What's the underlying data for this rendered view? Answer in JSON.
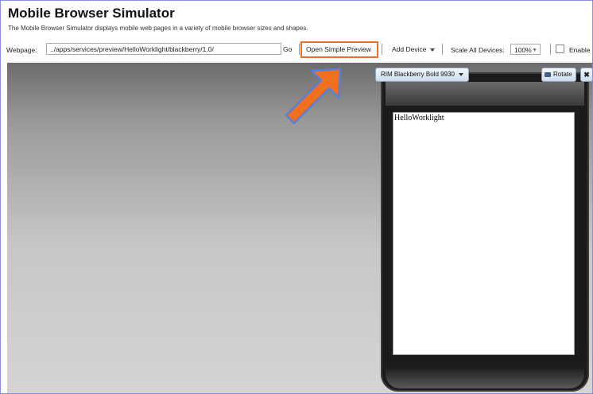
{
  "app": {
    "title": "Mobile Browser Simulator",
    "subtitle": "The Mobile Browser Simulator displays mobile web pages in a variety of mobile browser sizes and shapes."
  },
  "toolbar": {
    "webpage_label": "Webpage:",
    "url_value": "../apps/services/preview/HelloWorklight/blackberry/1.0/",
    "go_label": "Go",
    "open_preview_label": "Open Simple Preview",
    "add_device_label": "Add Device",
    "scale_label": "Scale All Devices:",
    "scale_value": "100%",
    "enable_label": "Enable"
  },
  "device": {
    "name": "RIM Blackberry Bold 9930",
    "rotate_label": "Rotate",
    "close_label": "✖",
    "screen_text": "HelloWorklight"
  },
  "colors": {
    "highlight": "#e8702a",
    "arrow": "#f07020",
    "arrow_outline": "#5a7fd6"
  }
}
